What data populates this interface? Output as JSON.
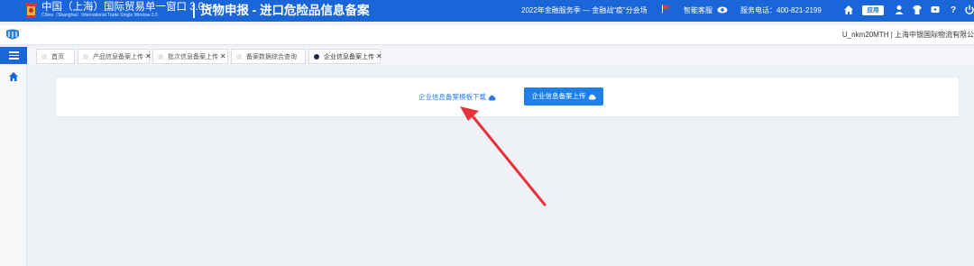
{
  "header": {
    "brand_title": "中国（上海）国际贸易单一窗口 3.0",
    "brand_subtitle": "China（Shanghai）International  Trade Single Window  3.0",
    "page_heading": "货物申报 - 进口危险品信息备案",
    "promo": "2022年金融服务季 — 金融战“疫”分会场",
    "service_link": "智能客服",
    "phone": "服务电话：400-821-2199",
    "apps_badge": "应用",
    "help": "?"
  },
  "userbar": {
    "user_info": "U_nkm20MTH | 上海中银国际物流有限公"
  },
  "tabs": [
    {
      "label": "首页",
      "closable": false,
      "active": false
    },
    {
      "label": "产品信息备案上传",
      "closable": true,
      "active": false
    },
    {
      "label": "批次信息备案上传",
      "closable": true,
      "active": false
    },
    {
      "label": "备案数据综合查询",
      "closable": true,
      "active": false
    },
    {
      "label": "企业信息备案上传",
      "closable": true,
      "active": true
    }
  ],
  "tab_close_glyph": "✕",
  "content": {
    "download_label": "企业信息备案模板下载",
    "upload_label": "企业信息备案上传"
  },
  "colors": {
    "header_bg": "#1a66d9",
    "primary_button": "#1e7fe4",
    "link": "#2d7be0",
    "annotation_arrow": "#e8323c"
  },
  "icons": {
    "flag": "red-flag-icon",
    "service": "eye-icon",
    "home": "home-icon",
    "apps": "apps-icon",
    "user": "user-icon",
    "shirt": "shirt-icon",
    "message": "message-icon",
    "help": "help-icon",
    "power": "power-icon",
    "cloud": "cloud-icon"
  }
}
